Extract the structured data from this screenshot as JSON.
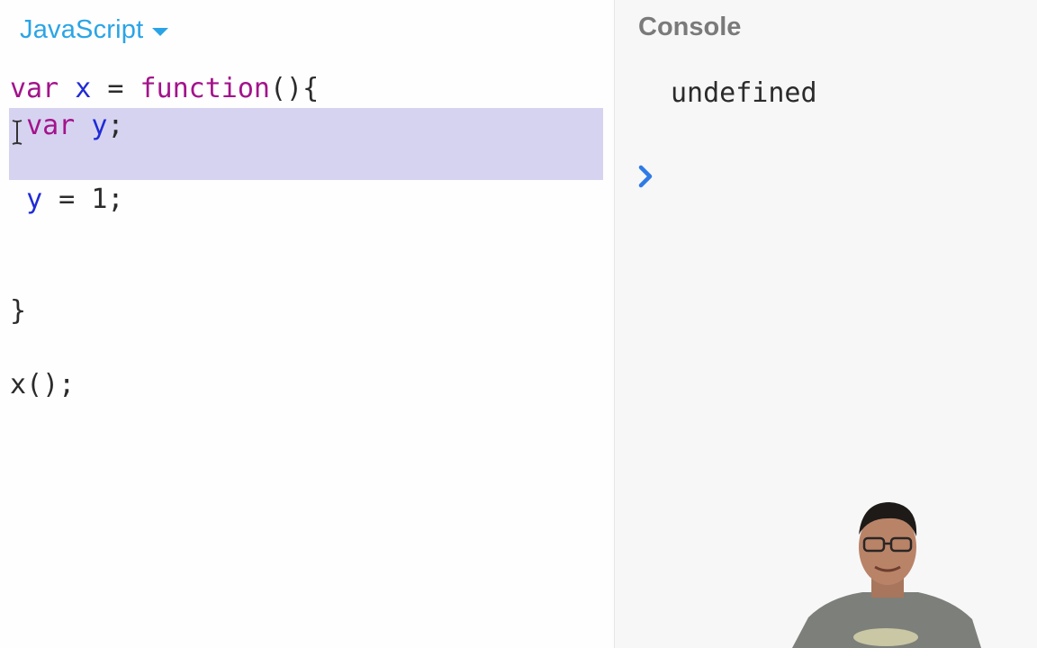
{
  "editor": {
    "language": "JavaScript",
    "lines": [
      {
        "tokens": [
          {
            "t": "var",
            "c": "kw"
          },
          {
            "t": " ",
            "c": "pl"
          },
          {
            "t": "x",
            "c": "id"
          },
          {
            "t": " = ",
            "c": "pl"
          },
          {
            "t": "function",
            "c": "kw"
          },
          {
            "t": "(){",
            "c": "pl"
          }
        ]
      },
      {
        "tokens": [
          {
            "t": " ",
            "c": "pl"
          },
          {
            "t": "var",
            "c": "kw"
          },
          {
            "t": " ",
            "c": "pl"
          },
          {
            "t": "y",
            "c": "id"
          },
          {
            "t": ";",
            "c": "pl"
          }
        ]
      },
      {
        "tokens": [
          {
            "t": " ",
            "c": "pl"
          },
          {
            "t": "y",
            "c": "id"
          },
          {
            "t": " = ",
            "c": "pl"
          },
          {
            "t": "1",
            "c": "pl"
          },
          {
            "t": ";",
            "c": "pl"
          }
        ]
      },
      {
        "tokens": [
          {
            "t": "}",
            "c": "pl"
          }
        ]
      },
      {
        "tokens": [
          {
            "t": "x",
            "c": "pl"
          },
          {
            "t": "();",
            "c": "pl"
          }
        ]
      }
    ]
  },
  "console": {
    "title": "Console",
    "output": "undefined",
    "prompt_icon": "chevron-right-icon"
  },
  "colors": {
    "keyword": "#a3138c",
    "identifier": "#1f2bd6",
    "accent": "#2aa4e6",
    "selection": "#d6d3f1"
  }
}
